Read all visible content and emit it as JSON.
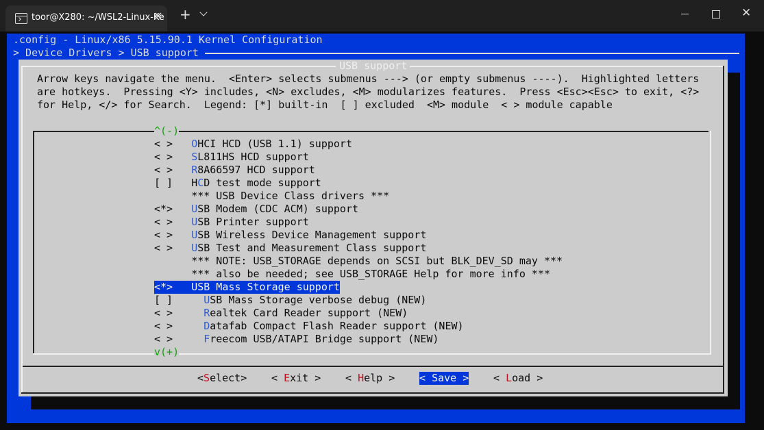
{
  "window": {
    "tab_title": "toor@X280: ~/WSL2-Linux-Ke",
    "tab_close": "✕",
    "new_tab": "+",
    "close_glyph": "✕"
  },
  "header": {
    "config_line": ".config - Linux/x86 5.15.90.1 Kernel Configuration",
    "breadcrumb": "> Device Drivers > USB support"
  },
  "dialog": {
    "title": "USB support",
    "help_lines": [
      "Arrow keys navigate the menu.  <Enter> selects submenus ---> (or empty submenus ----).  Highlighted letters",
      "are hotkeys.  Pressing <Y> includes, <N> excludes, <M> modularizes features.  Press <Esc><Esc> to exit, <?>",
      "for Help, </> for Search.  Legend: [*] built-in  [ ] excluded  <M> module  < > module capable"
    ],
    "scroll_up": "^(-)",
    "scroll_down": "v(+)"
  },
  "menu": {
    "items": [
      {
        "state": "< >",
        "indent": "",
        "hot": "O",
        "rest": "HCI HCD (USB 1.1) support",
        "pre": ""
      },
      {
        "state": "< >",
        "indent": "",
        "hot": "S",
        "rest": "L811HS HCD support",
        "pre": ""
      },
      {
        "state": "< >",
        "indent": "",
        "hot": "R",
        "rest": "8A66597 HCD support",
        "pre": ""
      },
      {
        "state": "[ ]",
        "indent": "",
        "hot": "C",
        "rest": "D test mode support",
        "pre": "H"
      },
      {
        "state": "   ",
        "indent": "",
        "hot": "",
        "rest": "*** USB Device Class drivers ***",
        "pre": ""
      },
      {
        "state": "<*>",
        "indent": "",
        "hot": "U",
        "rest": "SB Modem (CDC ACM) support",
        "pre": ""
      },
      {
        "state": "< >",
        "indent": "",
        "hot": "U",
        "rest": "SB Printer support",
        "pre": ""
      },
      {
        "state": "< >",
        "indent": "",
        "hot": "U",
        "rest": "SB Wireless Device Management support",
        "pre": ""
      },
      {
        "state": "< >",
        "indent": "",
        "hot": "U",
        "rest": "SB Test and Measurement Class support",
        "pre": ""
      },
      {
        "state": "   ",
        "indent": "",
        "hot": "",
        "rest": "*** NOTE: USB_STORAGE depends on SCSI but BLK_DEV_SD may ***",
        "pre": ""
      },
      {
        "state": "   ",
        "indent": "",
        "hot": "",
        "rest": "*** also be needed; see USB_STORAGE Help for more info ***",
        "pre": ""
      },
      {
        "state": "<*>",
        "indent": "",
        "hot": "",
        "rest": "USB Mass Storage support",
        "pre": "",
        "selected": true
      },
      {
        "state": "[ ]",
        "indent": "  ",
        "hot": "U",
        "rest": "SB Mass Storage verbose debug (NEW)",
        "pre": ""
      },
      {
        "state": "< >",
        "indent": "  ",
        "hot": "R",
        "rest": "ealtek Card Reader support (NEW)",
        "pre": ""
      },
      {
        "state": "< >",
        "indent": "  ",
        "hot": "D",
        "rest": "atafab Compact Flash Reader support (NEW)",
        "pre": ""
      },
      {
        "state": "< >",
        "indent": "  ",
        "hot": "F",
        "rest": "reecom USB/ATAPI Bridge support (NEW)",
        "pre": ""
      }
    ]
  },
  "buttons": [
    {
      "open": "<",
      "hot": "S",
      "rest": "elect",
      "close": ">",
      "active": false
    },
    {
      "open": "< ",
      "hot": "E",
      "rest": "xit",
      "close": " >",
      "active": false
    },
    {
      "open": "< ",
      "hot": "H",
      "rest": "elp",
      "close": " >",
      "active": false
    },
    {
      "open": "< ",
      "hot": "",
      "rest": "Save",
      "close": " >",
      "active": true
    },
    {
      "open": "< ",
      "hot": "L",
      "rest": "oad",
      "close": " >",
      "active": false
    }
  ]
}
